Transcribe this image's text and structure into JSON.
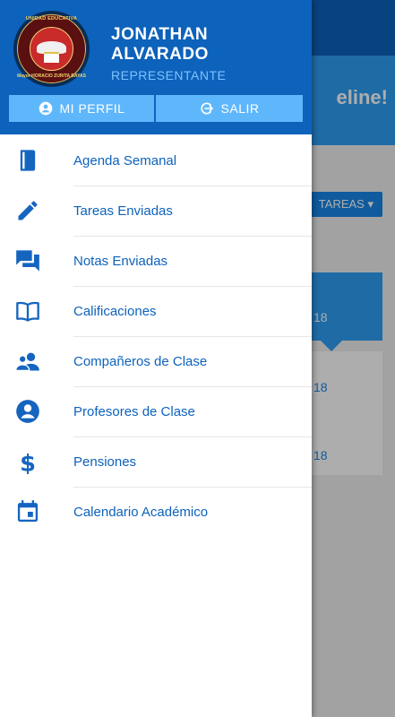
{
  "background": {
    "banner_text": "eline!",
    "tareas_button": "TAREAS",
    "card_dates": [
      "18",
      "18",
      "18"
    ]
  },
  "drawer": {
    "user": {
      "name": "JONATHAN ALVARADO",
      "role": "REPRESENTANTE"
    },
    "logo": {
      "top_text": "UNIDAD EDUCATIVA",
      "bottom_text": "Mayor HORACIO ZURITA BAYAS"
    },
    "buttons": {
      "profile": "MI PERFIL",
      "logout": "SALIR"
    },
    "menu": [
      {
        "label": "Agenda Semanal",
        "icon": "book-icon"
      },
      {
        "label": "Tareas Enviadas",
        "icon": "pencil-icon"
      },
      {
        "label": "Notas Enviadas",
        "icon": "chat-icon"
      },
      {
        "label": "Calificaciones",
        "icon": "open-book-icon"
      },
      {
        "label": "Compañeros de Clase",
        "icon": "people-icon"
      },
      {
        "label": "Profesores de Clase",
        "icon": "account-circle-icon"
      },
      {
        "label": "Pensiones",
        "icon": "dollar-icon"
      },
      {
        "label": "Calendario Académico",
        "icon": "calendar-icon"
      }
    ]
  },
  "colors": {
    "primary": "#0d62bb",
    "accent": "#5fb7fb",
    "icon": "#1565c0"
  }
}
